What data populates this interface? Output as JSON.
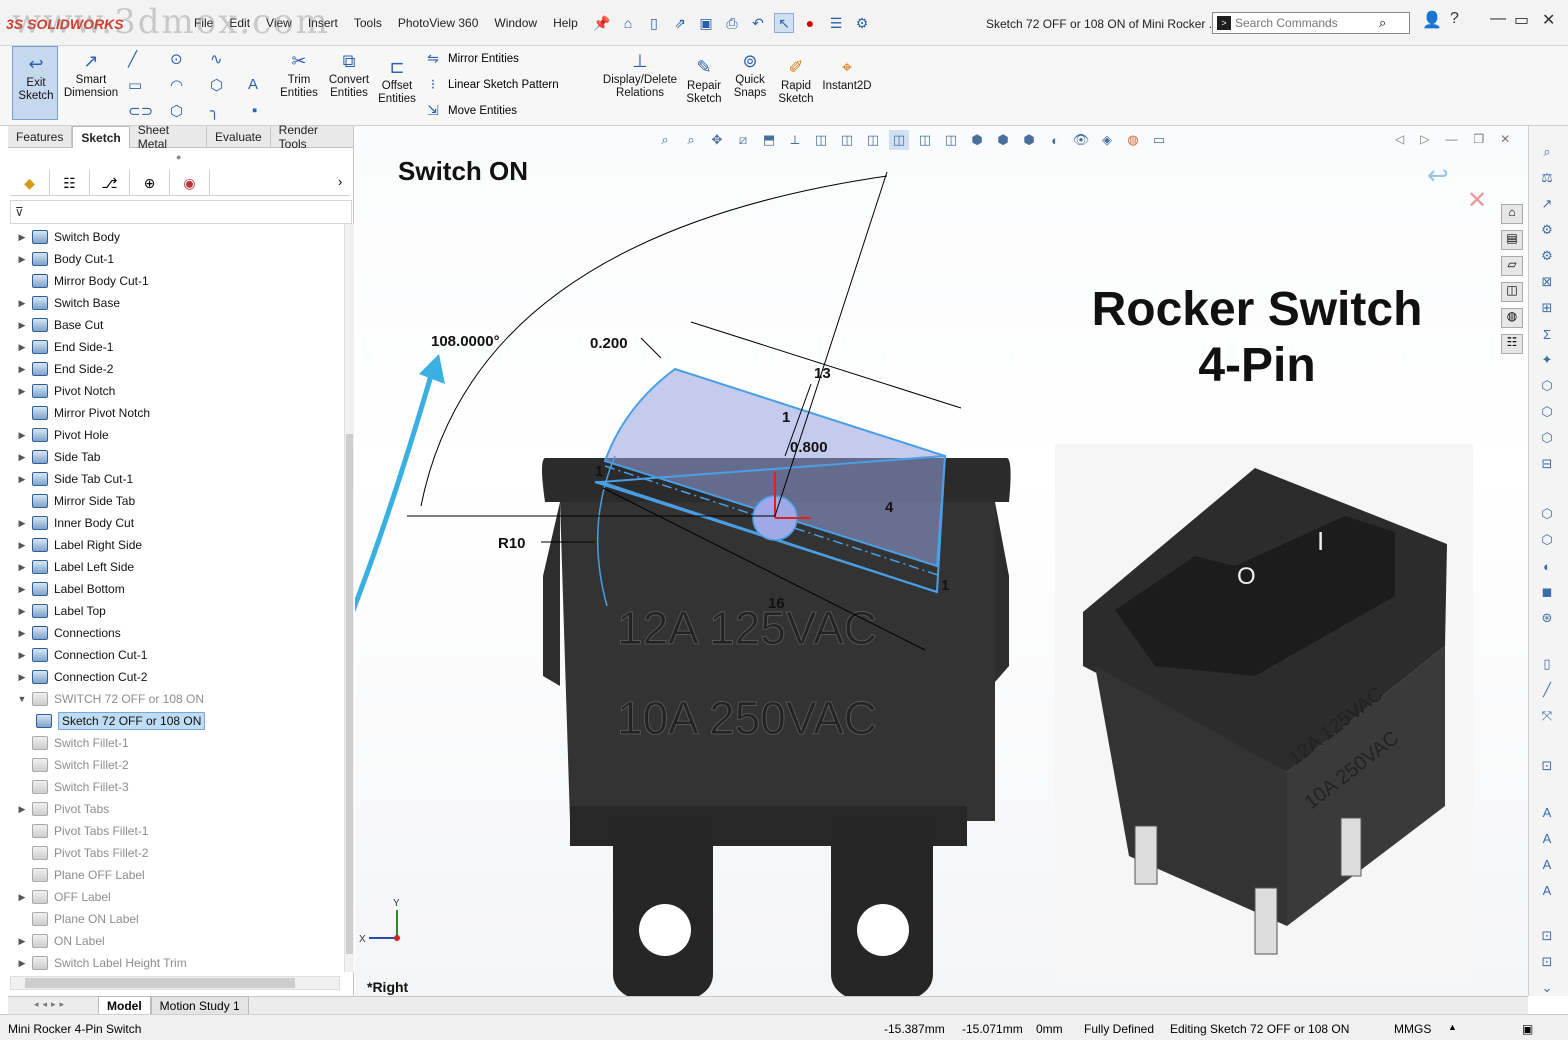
{
  "app": {
    "logo_text": "SOLIDWORKS",
    "document_title": "Sketch 72 OFF or 108 ON of Mini Rocker ...",
    "search_placeholder": "Search Commands",
    "menus": [
      "File",
      "Edit",
      "View",
      "Insert",
      "Tools",
      "PhotoView 360",
      "Window",
      "Help"
    ],
    "watermark": "www.3dmox.com"
  },
  "ribbon": {
    "exit_sketch": "Exit Sketch",
    "smart_dimension": "Smart Dimension",
    "trim_entities": "Trim Entities",
    "convert_entities": "Convert Entities",
    "offset_entities": "Offset Entities",
    "mirror_entities": "Mirror Entities",
    "linear_sketch_pattern": "Linear Sketch Pattern",
    "move_entities": "Move Entities",
    "display_delete_relations": "Display/Delete Relations",
    "repair_sketch": "Repair Sketch",
    "quick_snaps": "Quick Snaps",
    "rapid_sketch": "Rapid Sketch",
    "instant2d": "Instant2D"
  },
  "command_tabs": [
    "Features",
    "Sketch",
    "Sheet Metal",
    "Evaluate",
    "Render Tools"
  ],
  "feature_tree": [
    {
      "label": "Switch Body",
      "expand": true,
      "dim": false
    },
    {
      "label": "Body Cut-1",
      "expand": true,
      "dim": false
    },
    {
      "label": "Mirror Body Cut-1",
      "expand": false,
      "dim": false
    },
    {
      "label": "Switch Base",
      "expand": true,
      "dim": false
    },
    {
      "label": "Base Cut",
      "expand": true,
      "dim": false
    },
    {
      "label": "End Side-1",
      "expand": true,
      "dim": false
    },
    {
      "label": "End Side-2",
      "expand": true,
      "dim": false
    },
    {
      "label": "Pivot Notch",
      "expand": true,
      "dim": false
    },
    {
      "label": "Mirror Pivot Notch",
      "expand": false,
      "dim": false
    },
    {
      "label": "Pivot Hole",
      "expand": true,
      "dim": false
    },
    {
      "label": "Side Tab",
      "expand": true,
      "dim": false
    },
    {
      "label": "Side Tab Cut-1",
      "expand": true,
      "dim": false
    },
    {
      "label": "Mirror Side Tab",
      "expand": false,
      "dim": false
    },
    {
      "label": "Inner Body Cut",
      "expand": true,
      "dim": false
    },
    {
      "label": "Label Right Side",
      "expand": true,
      "dim": false
    },
    {
      "label": "Label Left Side",
      "expand": true,
      "dim": false
    },
    {
      "label": "Label Bottom",
      "expand": true,
      "dim": false
    },
    {
      "label": "Label Top",
      "expand": true,
      "dim": false
    },
    {
      "label": "Connections",
      "expand": true,
      "dim": false
    },
    {
      "label": "Connection Cut-1",
      "expand": true,
      "dim": false
    },
    {
      "label": "Connection Cut-2",
      "expand": true,
      "dim": false
    },
    {
      "label": "SWITCH 72 OFF or 108 ON",
      "expand": true,
      "dim": true
    },
    {
      "label": "Sketch 72 OFF or 108 ON",
      "expand": false,
      "dim": false,
      "selected": true
    },
    {
      "label": "Switch Fillet-1",
      "expand": false,
      "dim": true
    },
    {
      "label": "Switch Fillet-2",
      "expand": false,
      "dim": true
    },
    {
      "label": "Switch Fillet-3",
      "expand": false,
      "dim": true
    },
    {
      "label": "Pivot Tabs",
      "expand": true,
      "dim": true
    },
    {
      "label": "Pivot Tabs Fillet-1",
      "expand": false,
      "dim": true
    },
    {
      "label": "Pivot Tabs Fillet-2",
      "expand": false,
      "dim": true
    },
    {
      "label": "Plane OFF Label",
      "expand": false,
      "dim": true
    },
    {
      "label": "OFF Label",
      "expand": true,
      "dim": true
    },
    {
      "label": "Plane ON Label",
      "expand": false,
      "dim": true
    },
    {
      "label": "ON Label",
      "expand": true,
      "dim": true
    },
    {
      "label": "Switch Label Height Trim",
      "expand": true,
      "dim": true
    }
  ],
  "viewport": {
    "caption_left": "Switch ON",
    "title_line1": "Rocker Switch",
    "title_line2": "4-Pin",
    "view_name": "*Right",
    "axis_x": "X",
    "axis_y": "Y",
    "body_text1": "12A 125VAC",
    "body_text2": "10A 250VAC",
    "iso_text1": "12A 125VAC",
    "iso_text2": "10A 250VAC",
    "iso_symbol_off": "O",
    "iso_symbol_on": "I",
    "dims": {
      "angle": "108.0000°",
      "d0200": "0.200",
      "d13": "13",
      "d1a": "1",
      "d0800": "0.800",
      "d4": "4",
      "d16": "16",
      "d1b": "1",
      "d1c": "1",
      "r10": "R10"
    }
  },
  "bottom_tabs": [
    "Model",
    "Motion Study 1"
  ],
  "status": {
    "doc": "Mini Rocker 4-Pin Switch",
    "x": "-15.387mm",
    "y": "-15.071mm",
    "z": "0mm",
    "defined": "Fully Defined",
    "editing": "Editing Sketch 72 OFF or 108 ON",
    "units": "MMGS"
  },
  "colors": {
    "accent": "#2d62b0",
    "sketch_blue": "#4a9fe4",
    "annotation_arrow": "#3ab0e2",
    "body_dark": "#2a2a2a"
  }
}
